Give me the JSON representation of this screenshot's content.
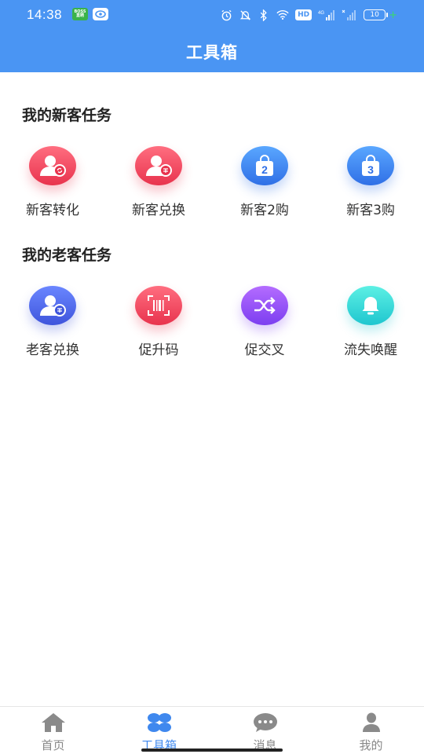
{
  "status_bar": {
    "time": "14:38",
    "app_badge_text": "BOSS直聘",
    "hd_label": "HD",
    "network_label": "4G",
    "battery_level": "10",
    "icons": [
      "app-badge-icon",
      "eye-icon",
      "alarm-icon",
      "mute-icon",
      "bluetooth-icon",
      "wifi-icon",
      "signal-icon",
      "battery-icon",
      "charging-icon"
    ]
  },
  "header": {
    "title": "工具箱"
  },
  "sections": [
    {
      "title": "我的新客任务",
      "items": [
        {
          "label": "新客转化",
          "icon": "user-convert-icon",
          "color": "#e8334d"
        },
        {
          "label": "新客兑换",
          "icon": "user-exchange-icon",
          "color": "#e8334d"
        },
        {
          "label": "新客2购",
          "icon": "bag-2-icon",
          "badge": "2",
          "color": "#2f6fe6"
        },
        {
          "label": "新客3购",
          "icon": "bag-3-icon",
          "badge": "3",
          "color": "#2f6fe6"
        }
      ]
    },
    {
      "title": "我的老客任务",
      "items": [
        {
          "label": "老客兑换",
          "icon": "user-exchange-icon",
          "color": "#3f55dc"
        },
        {
          "label": "促升码",
          "icon": "scan-code-icon",
          "color": "#e8334d"
        },
        {
          "label": "促交叉",
          "icon": "shuffle-icon",
          "color": "#7c3ef0"
        },
        {
          "label": "流失唤醒",
          "icon": "bell-icon",
          "color": "#1fc6cf"
        }
      ]
    }
  ],
  "tabbar": {
    "active_index": 1,
    "active_color": "#3f88ee",
    "inactive_color": "#888888",
    "tabs": [
      {
        "label": "首页",
        "icon": "home-icon"
      },
      {
        "label": "工具箱",
        "icon": "toolbox-icon"
      },
      {
        "label": "消息",
        "icon": "message-icon"
      },
      {
        "label": "我的",
        "icon": "profile-icon"
      }
    ]
  }
}
